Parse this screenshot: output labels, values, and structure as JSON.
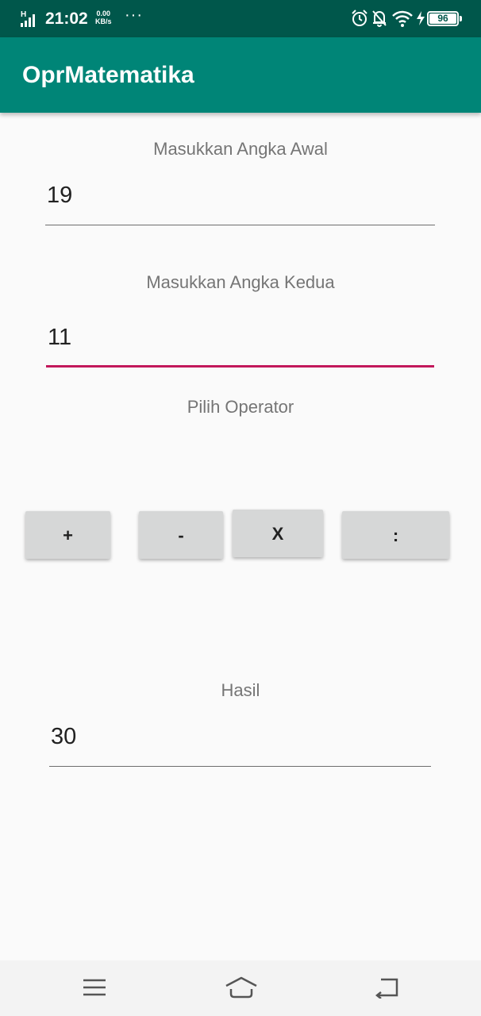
{
  "status_bar": {
    "network": "H",
    "time": "21:02",
    "speed_value": "0.00",
    "speed_unit": "KB/s",
    "more": "···",
    "battery": "96"
  },
  "app_bar": {
    "title": "OprMatematika"
  },
  "form": {
    "first_label": "Masukkan Angka Awal",
    "first_value": "19",
    "second_label": "Masukkan Angka Kedua",
    "second_value": "11",
    "operator_label": "Pilih Operator",
    "operators": [
      "+",
      "-",
      "X",
      ":"
    ],
    "result_label": "Hasil",
    "result_value": "30"
  },
  "colors": {
    "status_bar": "#00574b",
    "app_bar": "#008577",
    "accent": "#c2185b",
    "button": "#d6d7d7"
  },
  "icons": {
    "status": [
      "signal-icon",
      "alarm-icon",
      "notifications-off-icon",
      "wifi-icon",
      "charging-icon",
      "battery-icon"
    ],
    "nav": [
      "menu-icon",
      "home-icon",
      "back-icon"
    ]
  }
}
